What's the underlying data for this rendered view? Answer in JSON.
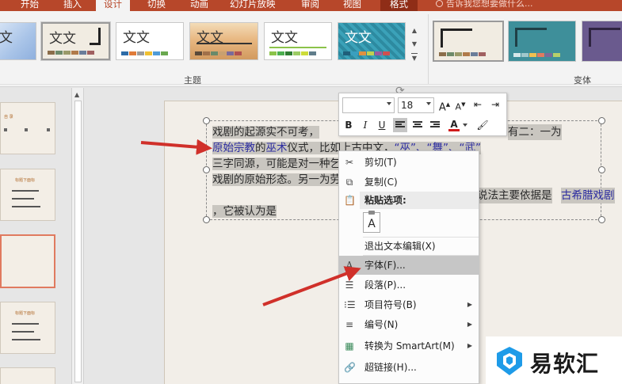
{
  "ribbon": {
    "tabs": [
      "开始",
      "插入",
      "设计",
      "切换",
      "动画",
      "幻灯片放映",
      "审阅",
      "视图",
      "格式"
    ],
    "active_tab": "设计",
    "tell_me": "告诉我您想要做什么...",
    "theme_group_label": "主题",
    "variant_group_label": "变体",
    "themes": [
      {
        "sample": "文",
        "accent": "#a9c4e8"
      },
      {
        "sample": "文文",
        "accent": "#222222"
      },
      {
        "sample": "文文",
        "accent": "#2e6ca8"
      },
      {
        "sample": "文文",
        "accent": "#d8a36a"
      },
      {
        "sample": "文文",
        "accent": "#8bc34a"
      },
      {
        "sample": "文文",
        "accent": "#2d9bb5"
      }
    ]
  },
  "slide": {
    "paragraph_parts": [
      "戏剧的起源实不可考，",
      "有二：一为",
      "原始宗教",
      "的",
      "巫术",
      "仪式，比如上古中文，",
      "“巫”、“舞”、“武”",
      "三字同源，可能是对一种乞求战斗胜",
      "戏剧的原始形态。另一为劳动或庆祝丰收",
      "说法主要依据是",
      "古希腊戏剧",
      "，它被认为是"
    ]
  },
  "mini_toolbar": {
    "font_name": "",
    "font_size": "18",
    "bold": "B",
    "italic": "I",
    "underline": "U",
    "grow_font": "A",
    "shrink_font": "A",
    "font_color": "A"
  },
  "context_menu": {
    "cut": "剪切(T)",
    "copy": "复制(C)",
    "paste_options": "粘贴选项:",
    "paste_keep_text": "A",
    "exit_edit": "退出文本编辑(X)",
    "font": "字体(F)...",
    "paragraph": "段落(P)...",
    "bullets": "项目符号(B)",
    "numbering": "编号(N)",
    "smartart": "转换为 SmartArt(M)",
    "hyperlink": "超链接(H)..."
  },
  "thumbnails": [
    {
      "title": "自  录"
    },
    {
      "title": "标题下面标"
    },
    {
      "title": ""
    },
    {
      "title": "标题下面标"
    }
  ],
  "watermark": {
    "text": "易软汇"
  },
  "colors": {
    "accent": "#b7472a",
    "arrow": "#d0302a",
    "link": "#2b2ba0"
  }
}
